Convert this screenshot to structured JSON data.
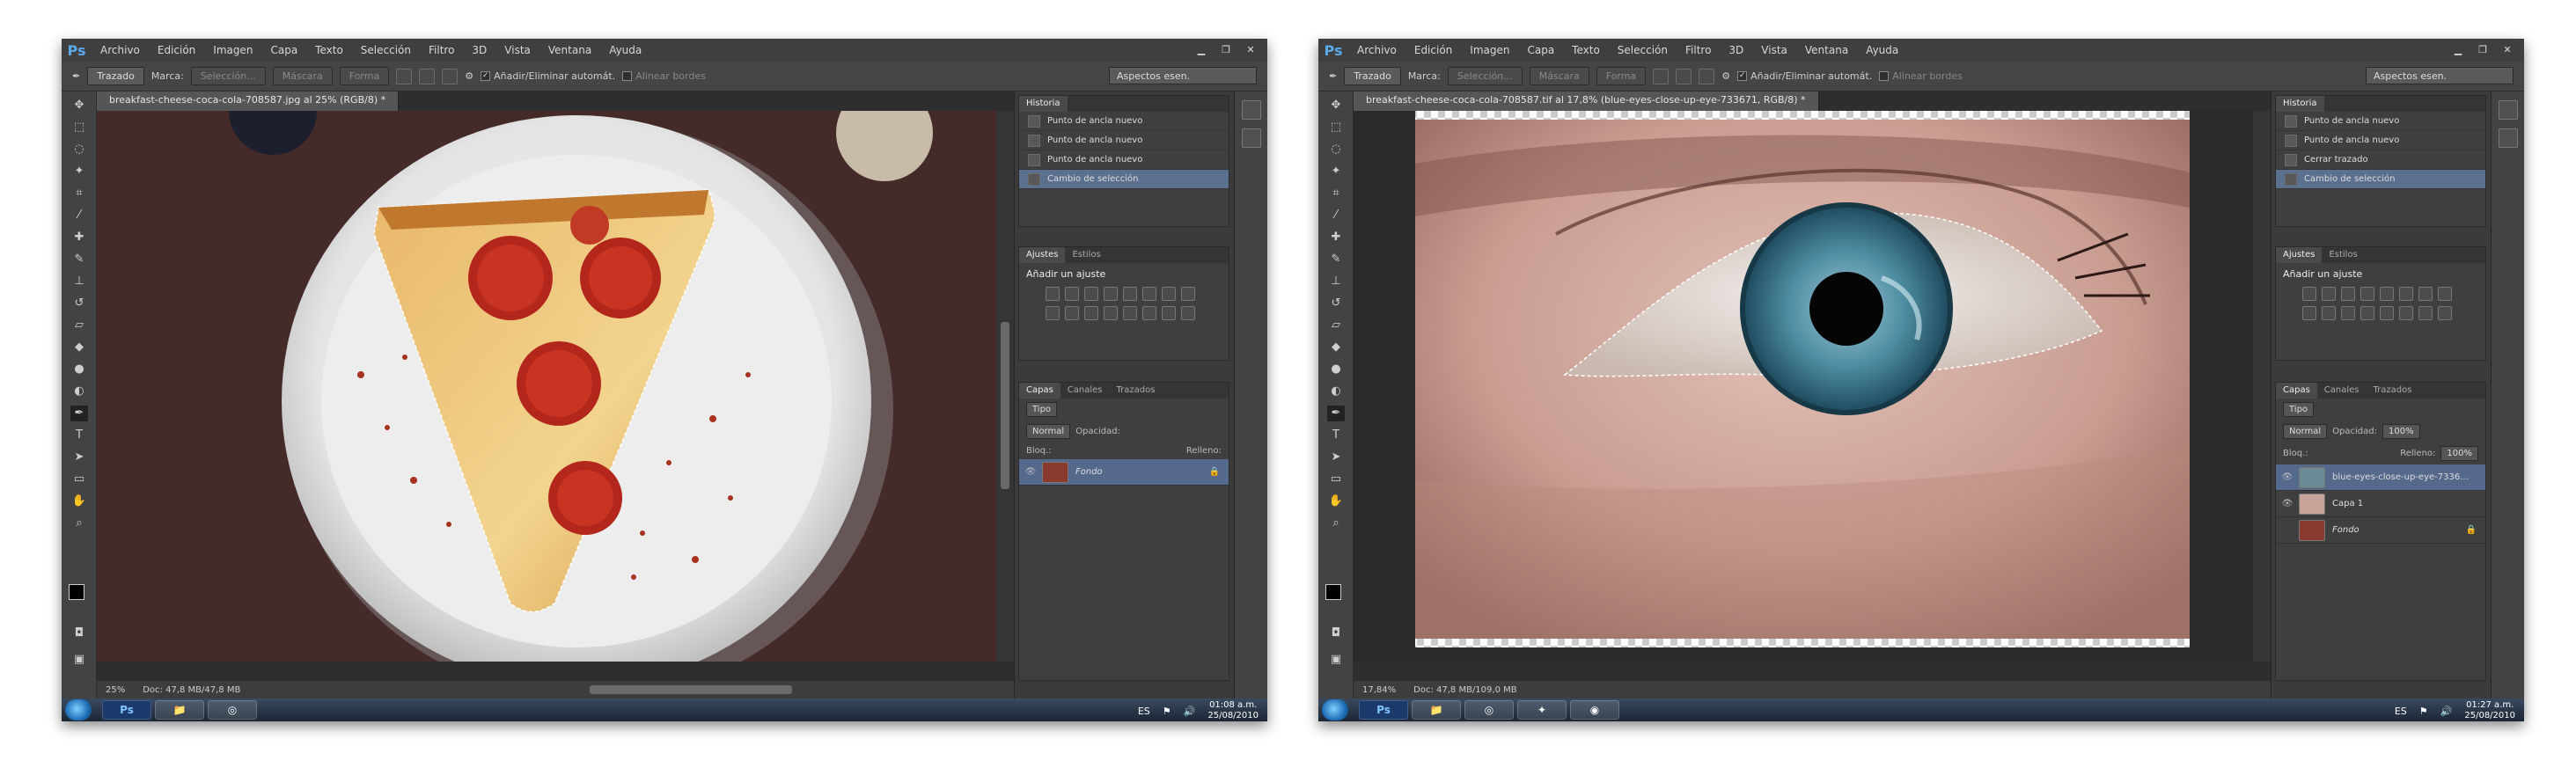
{
  "menu": [
    "Archivo",
    "Edición",
    "Imagen",
    "Capa",
    "Texto",
    "Selección",
    "Filtro",
    "3D",
    "Vista",
    "Ventana",
    "Ayuda"
  ],
  "options": {
    "mode": "Trazado",
    "marca": "Marca:",
    "sel": "Selección...",
    "mask": "Máscara",
    "forma": "Forma",
    "auto": "Añadir/Eliminar automát.",
    "align": "Alinear bordes",
    "workspace": "Aspectos esen."
  },
  "panels": {
    "historia": "Historia",
    "ajustes": "Ajustes",
    "estilos": "Estilos",
    "add_adj": "Añadir un ajuste",
    "capas": "Capas",
    "canales": "Canales",
    "trazados": "Trazados",
    "tipo": "Tipo",
    "normal": "Normal",
    "opacidad": "Opacidad:",
    "bloq": "Bloq.:",
    "relleno": "Relleno:"
  },
  "w1": {
    "tab": "breakfast-cheese-coca-cola-708587.jpg al 25% (RGB/8) *",
    "history": [
      "Punto de ancla nuevo",
      "Punto de ancla nuevo",
      "Punto de ancla nuevo",
      "Cambio de selección"
    ],
    "layers": [
      "Fondo"
    ],
    "zoom": "25%",
    "doc": "Doc: 47,8 MB/47,8 MB",
    "time": "01:08 a.m.",
    "date": "25/08/2010",
    "lang": "ES"
  },
  "w2": {
    "tab": "breakfast-cheese-coca-cola-708587.tif al 17,8% (blue-eyes-close-up-eye-733671, RGB/8) *",
    "history": [
      "Punto de ancla nuevo",
      "Punto de ancla nuevo",
      "Cerrar trazado",
      "Cambio de selección"
    ],
    "layers": [
      "blue-eyes-close-up-eye-7336...",
      "Capa 1",
      "Fondo"
    ],
    "zoom": "17,84%",
    "doc": "Doc: 47,8 MB/109,0 MB",
    "opacity": "100%",
    "fill": "100%",
    "time": "01:27 a.m.",
    "date": "25/08/2010",
    "lang": "ES"
  },
  "taskbar_apps": [
    "Ps"
  ]
}
